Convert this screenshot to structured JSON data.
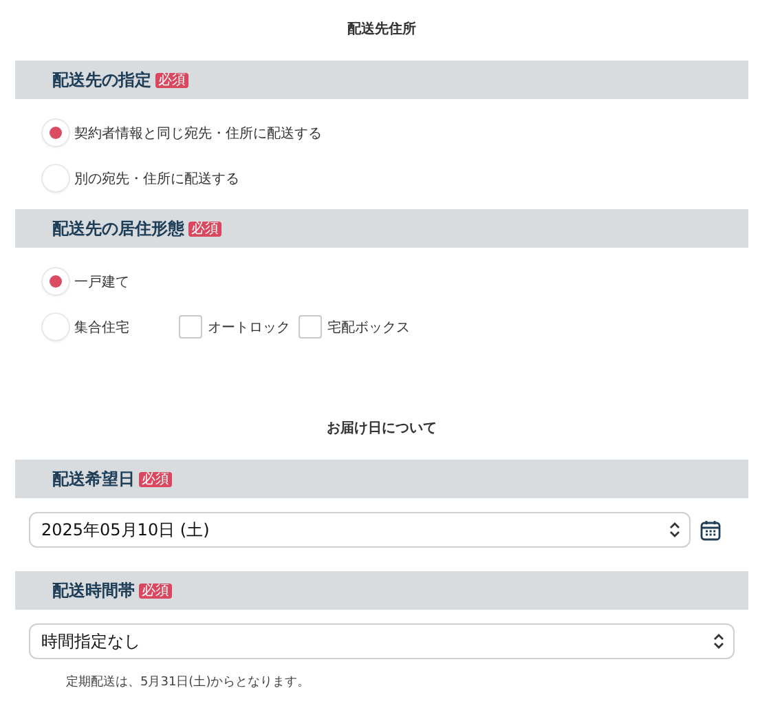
{
  "groups": [
    {
      "title": "配送先住所",
      "sections": [
        {
          "kind": "radios",
          "heading": "配送先の指定",
          "badge": "必須",
          "rows": [
            {
              "options": [
                {
                  "kind": "radio",
                  "label": "契約者情報と同じ宛先・住所に配送する",
                  "selected": true
                }
              ]
            },
            {
              "options": [
                {
                  "kind": "radio",
                  "label": "別の宛先・住所に配送する",
                  "selected": false
                }
              ]
            }
          ]
        },
        {
          "kind": "radios",
          "heading": "配送先の居住形態",
          "badge": "必須",
          "rows": [
            {
              "options": [
                {
                  "kind": "radio",
                  "label": "一戸建て",
                  "selected": true
                }
              ]
            },
            {
              "options": [
                {
                  "kind": "radio",
                  "label": "集合住宅",
                  "selected": false
                },
                {
                  "kind": "checkbox",
                  "label": "オートロック",
                  "checked": false
                },
                {
                  "kind": "checkbox",
                  "label": "宅配ボックス",
                  "checked": false
                }
              ]
            }
          ]
        }
      ]
    },
    {
      "title": "お届け日について",
      "sections": [
        {
          "kind": "select",
          "heading": "配送希望日",
          "badge": "必須",
          "value": "2025年05月10日 (土)",
          "calendar": true
        },
        {
          "kind": "select",
          "heading": "配送時間帯",
          "badge": "必須",
          "value": "時間指定なし",
          "calendar": false,
          "note": "定期配送は、5月31日(土)からとなります。"
        }
      ]
    }
  ]
}
